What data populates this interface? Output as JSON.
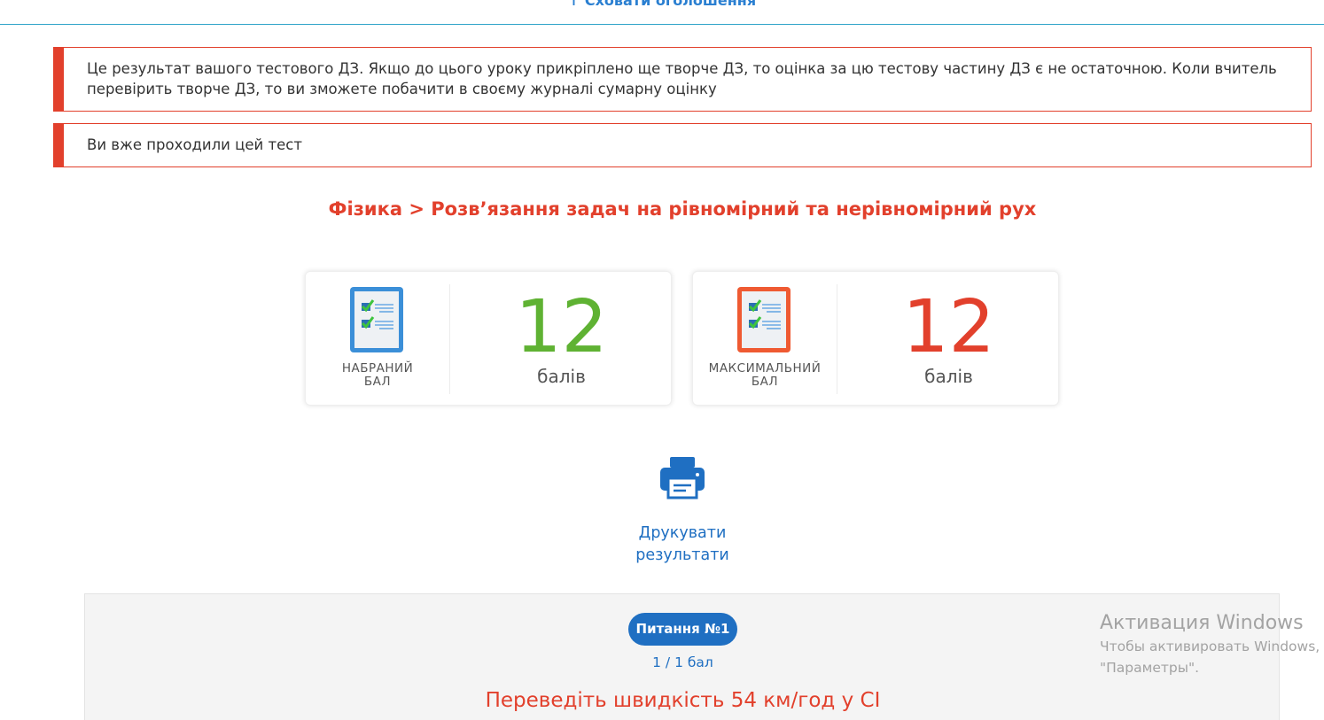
{
  "header": {
    "hide_ads_label": "↑ Сховати оголошення"
  },
  "alerts": [
    "Це результат вашого тестового ДЗ. Якщо до цього уроку прикріплено ще творче ДЗ, то оцінка за цю тестову частину ДЗ є не остаточною. Коли вчитель перевірить творче ДЗ, то ви зможете побачити в своєму журналі сумарну оцінку",
    "Ви вже проходили цей тест"
  ],
  "breadcrumb_title": "Фізика > Розв’язання задач на рівномірний та нерівномірний рух",
  "scores": [
    {
      "label_line1": "НАБРАНИЙ",
      "label_line2": "БАЛ",
      "value": "12",
      "unit": "балів",
      "icon": "checklist-blue-icon",
      "color": "#5fb233"
    },
    {
      "label_line1": "МАКСИМАЛЬНИЙ",
      "label_line2": "БАЛ",
      "value": "12",
      "unit": "балів",
      "icon": "checklist-red-icon",
      "color": "#e2402c"
    }
  ],
  "print": {
    "label_line1": "Друкувати",
    "label_line2": "результати",
    "icon": "printer-icon"
  },
  "question": {
    "badge": "Питання №1",
    "points": "1 / 1 бал",
    "text": "Переведіть швидкість 54 км/год у СІ"
  },
  "watermark": {
    "title": "Активация Windows",
    "line1": "Чтобы активировать Windows,",
    "line2": "\"Параметры\"."
  },
  "colors": {
    "accent_red": "#e2402c",
    "accent_blue": "#1f6fc2",
    "green": "#5fb233"
  }
}
